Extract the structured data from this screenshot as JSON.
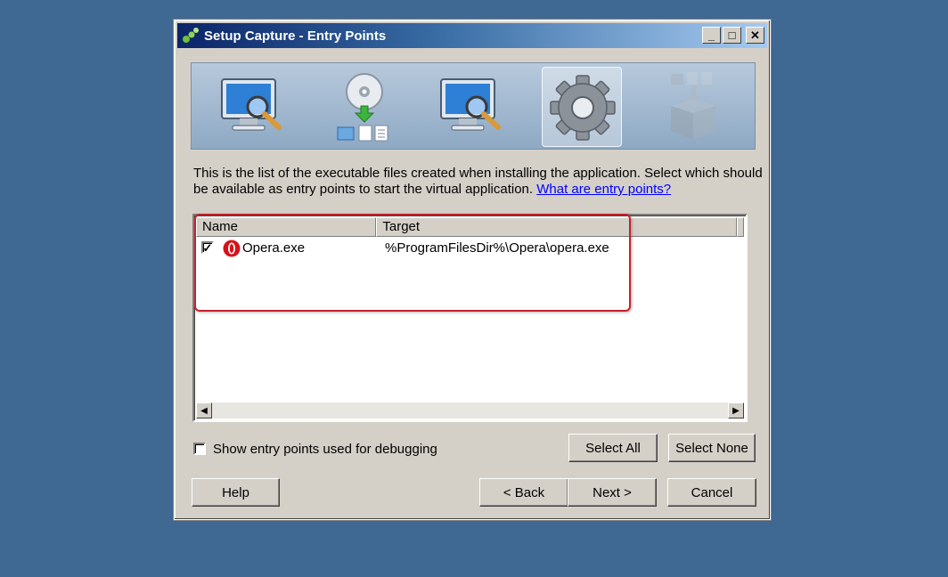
{
  "window": {
    "title": "Setup Capture - Entry Points",
    "title_buttons": {
      "minimize": "_",
      "maximize": "□",
      "close": "✕"
    }
  },
  "banner": {
    "steps": [
      {
        "icon": "monitor-magnifier-icon"
      },
      {
        "icon": "cd-install-icon"
      },
      {
        "icon": "monitor-magnifier-icon"
      },
      {
        "icon": "gear-icon",
        "active": true
      },
      {
        "icon": "package-box-icon",
        "disabled": true
      }
    ]
  },
  "description": {
    "text": "This is the list of the executable files created when installing the application. Select which should be available as entry points to start the virtual application.",
    "link": "What are entry points?"
  },
  "list": {
    "columns": [
      "Name",
      "Target"
    ],
    "rows": [
      {
        "checked": true,
        "icon": "opera-icon",
        "name": "Opera.exe",
        "target": "%ProgramFilesDir%\\Opera\\opera.exe"
      }
    ]
  },
  "debug_option": {
    "label": "Show entry points used for debugging",
    "checked": false
  },
  "buttons": {
    "select_all": "Select All",
    "select_none": "Select None",
    "help": "Help",
    "back": "< Back",
    "next": "Next >",
    "cancel": "Cancel"
  },
  "colors": {
    "desktop": "#3f6893",
    "dialog": "#d4d0c8",
    "highlight_box": "#c8202a",
    "link": "#0000ff"
  }
}
